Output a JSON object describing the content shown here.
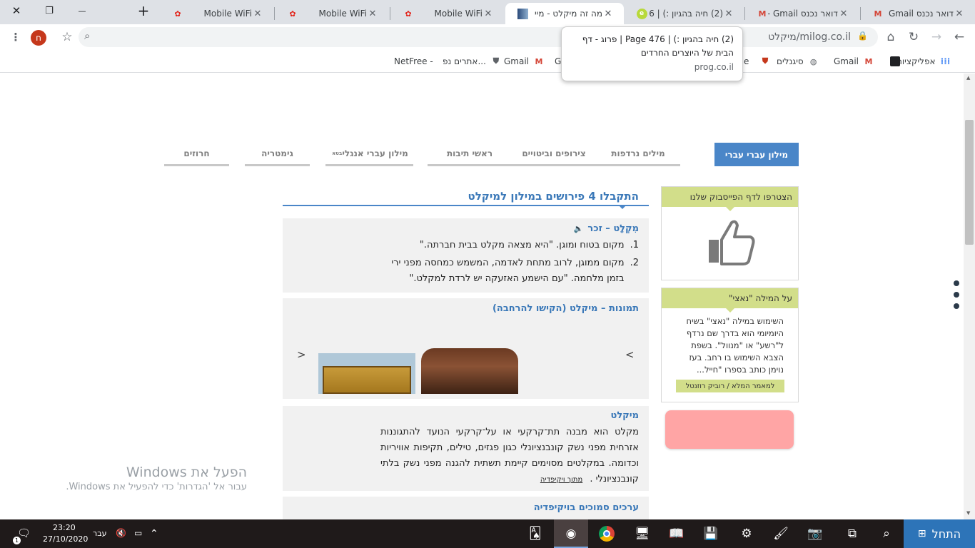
{
  "tabs": [
    {
      "title": "דואר נכנס Gmail",
      "favicon": "gmail-icon",
      "active": false
    },
    {
      "title": "דואר נכנס Gmail -",
      "favicon": "gmail-icon",
      "active": false
    },
    {
      "title": "(2) חיה בהגיון :) | 6",
      "favicon": "prog-icon",
      "active": false
    },
    {
      "title": "מה זה מיקלט - מיי",
      "favicon": "milog-icon",
      "active": true
    },
    {
      "title": "Mobile WiFi",
      "favicon": "huawei-icon",
      "active": false
    },
    {
      "title": "Mobile WiFi",
      "favicon": "huawei-icon",
      "active": false
    },
    {
      "title": "Mobile WiFi",
      "favicon": "huawei-icon",
      "active": false
    }
  ],
  "window": {
    "new_tab": "+",
    "minimize": "—",
    "restore": "❐",
    "close": "✕"
  },
  "address_bar": {
    "url": "milog.co.il/מיקלט",
    "avatar_letter": "ח"
  },
  "bookmarks": [
    {
      "label": "אפליקציות",
      "icon": "apps-grid-icon"
    },
    {
      "label": "",
      "icon": "bookmark-app-icon"
    },
    {
      "label": "Gmail",
      "icon": "gmail-icon"
    },
    {
      "label": "סיגנלים",
      "icon": "globe-icon"
    },
    {
      "label": "",
      "icon": "shield-icon"
    },
    {
      "label": "Gmail",
      "icon": "gmail-icon"
    },
    {
      "label": "אתרים נפ...",
      "icon": "shield-icon"
    },
    {
      "label": "NetFree -",
      "icon": ""
    }
  ],
  "bookmarks_partial": {
    "g1": "G",
    "e1": "e"
  },
  "tooltip": {
    "line1": "(2) חיה בהגיון :) | Page 476 | פרוג - דף הבית של היוצרים החרדים",
    "host": "prog.co.il"
  },
  "nav_tabs": [
    {
      "label": "מילון עברי עברי",
      "active": true
    },
    {
      "label": "מילים נרדפות",
      "active": false
    },
    {
      "label": "צירופים וביטויים",
      "active": false
    },
    {
      "label": "ראשי תיבות",
      "active": false
    },
    {
      "label": "מילון עברי אנגלי",
      "badge": "בטא",
      "active": false
    },
    {
      "label": "גימטריה",
      "active": false
    },
    {
      "label": "חרוזים",
      "active": false
    }
  ],
  "results_heading": "התקבלו 4 פירושים במילון למיקלט",
  "definition": {
    "title": "מִקְלָט – זכר",
    "items": [
      {
        "num": "1.",
        "text": "מקום בטוח ומוגן. \"היא מצאה מקלט בבית חברתה.\""
      },
      {
        "num": "2.",
        "text": "מקום ממוגן, לרוב מתחת לאדמה, המשמש כמחסה מפני ירי בזמן מלחמה. \"עם הישמע האזעקה יש לרדת למקלט.\""
      }
    ]
  },
  "images": {
    "title": "תמונות – מיקלט (הקישו להרחבה)",
    "prev": "<",
    "next": ">"
  },
  "wiki": {
    "title": "מיקלט",
    "text": "מקלט הוא מבנה תת־קרקעי או על־קרקעי הנועד להתגוננות אזרחית מפני נשק קונבנציונלי כגון פגזים, טילים, תקיפות אוויריות וכדומה. במקלטים מסוימים קיימת תשתית להגנה מפני נשק בלתי קונבנציונלי .",
    "source": "מתוך ויקיפדיה"
  },
  "related_heading": "ערכים סמוכים בויקיפדיה",
  "facebook_box": {
    "title": "הצטרפו לדף הפייסבוק שלנו",
    "icon": "thumbs-up-icon"
  },
  "word_box": {
    "title": "על המילה \"נאצי\"",
    "text": "השימוש במילה \"נאצי\" בשיח היומיומי הוא בדרך שם נרדף ל\"רשע\" או \"מנוול\". בשפת הצבא השימוש בו רחב. בעז נוימן כותב בספרו \"חייל...",
    "link": "למאמר המלא / רוביק רוזנטל"
  },
  "activation": {
    "title": "הפעל את Windows",
    "subtitle": "עבור אל 'הגדרות' כדי להפעיל את Windows."
  },
  "taskbar": {
    "start": "התחל",
    "time": "23:20",
    "date": "27/10/2020",
    "lang": "עבר",
    "notif_count": "1"
  },
  "colors": {
    "accent_blue": "#4a86c8",
    "side_green": "#d2de8a",
    "pink_button": "#ffa5a5",
    "start_blue": "#2d74b8"
  }
}
